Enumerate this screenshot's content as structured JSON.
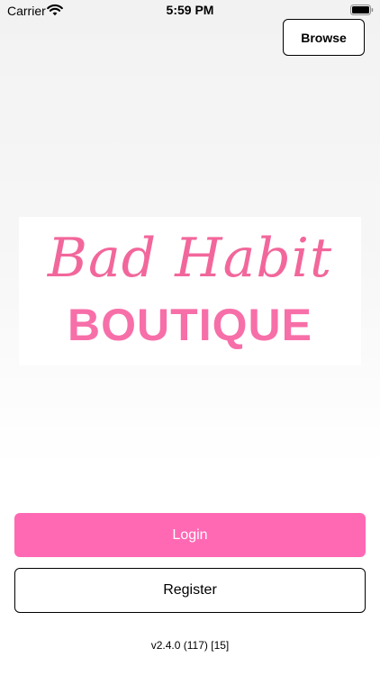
{
  "status_bar": {
    "carrier": "Carrier",
    "time": "5:59 PM",
    "wifi_icon": "wifi-icon",
    "battery_icon": "battery-icon"
  },
  "header": {
    "browse_label": "Browse"
  },
  "logo": {
    "script_text": "Bad Habit",
    "block_text": "BOUTIQUE",
    "script_color": "#f2679b",
    "block_color": "#f76fa8"
  },
  "actions": {
    "login_label": "Login",
    "register_label": "Register",
    "login_color": "#ff69b4"
  },
  "footer": {
    "version": "v2.4.0 (117) [15]"
  }
}
